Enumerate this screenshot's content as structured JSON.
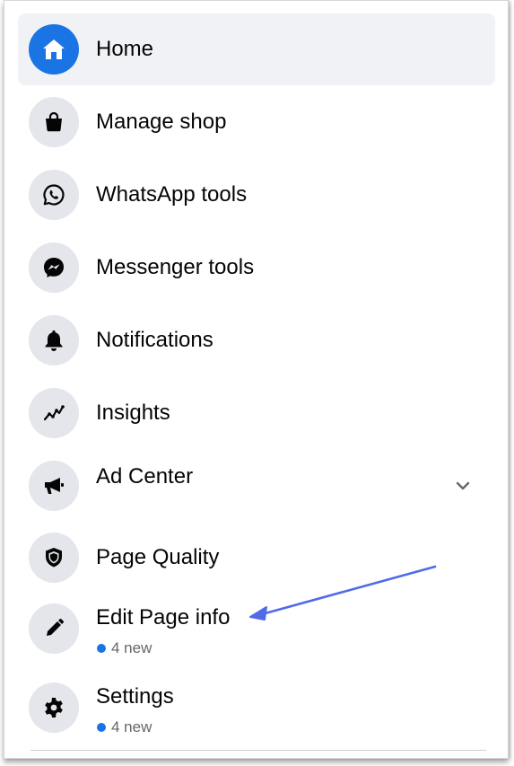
{
  "menu": {
    "items": [
      {
        "label": "Home",
        "icon": "home-icon",
        "active": true
      },
      {
        "label": "Manage shop",
        "icon": "shopping-bag-icon"
      },
      {
        "label": "WhatsApp tools",
        "icon": "whatsapp-icon"
      },
      {
        "label": "Messenger tools",
        "icon": "messenger-icon"
      },
      {
        "label": "Notifications",
        "icon": "bell-icon"
      },
      {
        "label": "Insights",
        "icon": "insights-icon"
      },
      {
        "label": "Ad Center",
        "icon": "megaphone-icon",
        "expandable": true
      },
      {
        "label": "Page Quality",
        "icon": "shield-icon"
      },
      {
        "label": "Edit Page info",
        "icon": "pencil-icon",
        "badge": "4 new"
      },
      {
        "label": "Settings",
        "icon": "gear-icon",
        "badge": "4 new"
      }
    ]
  },
  "colors": {
    "accent": "#1b74e4",
    "active_bg": "#f0f2f5",
    "icon_bg": "#e4e6eb",
    "arrow": "#4f6be8"
  }
}
